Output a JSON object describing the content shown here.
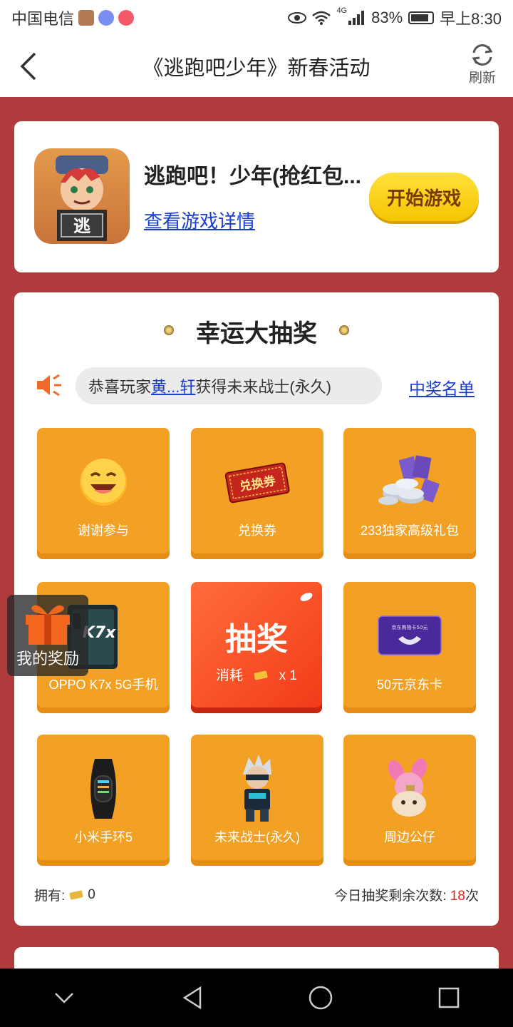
{
  "status_bar": {
    "carrier": "中国电信",
    "network": "4G",
    "battery": "83%",
    "time": "早上8:30"
  },
  "nav": {
    "title": "《逃跑吧少年》新春活动",
    "refresh_label": "刷新"
  },
  "game": {
    "name": "逃跑吧！少年(抢红包...",
    "icon_text": "逃",
    "detail_link": "查看游戏详情",
    "start_button": "开始游戏"
  },
  "lottery": {
    "title": "幸运大抽奖",
    "marquee_prefix": "恭喜玩家",
    "marquee_player": "黄...轩",
    "marquee_suffix": "获得未来战士(永久)",
    "winners_link": "中奖名单",
    "prizes": [
      {
        "label": "谢谢参与",
        "icon": "smiley-icon"
      },
      {
        "label": "兑换券",
        "icon": "coupon-icon",
        "art_text": "兑换券"
      },
      {
        "label": "233独家高级礼包",
        "icon": "coins-icon"
      },
      {
        "label": "OPPO K7x 5G手机",
        "icon": "phone-icon",
        "art_text": "K7x"
      },
      {
        "label": "50元京东卡",
        "icon": "jd-card-icon",
        "art_text": "京东购物卡50元"
      },
      {
        "label": "小米手环5",
        "icon": "band-icon"
      },
      {
        "label": "未来战士(永久)",
        "icon": "warrior-icon"
      },
      {
        "label": "周边公仔",
        "icon": "doll-icon"
      }
    ],
    "draw_button": "抽奖",
    "draw_cost_prefix": "消耗",
    "draw_cost_amount": "x 1",
    "own_label": "拥有:",
    "own_count": "0",
    "remain_label": "今日抽奖剩余次数: ",
    "remain_count": "18",
    "remain_unit": "次"
  },
  "my_reward": {
    "label": "我的奖励"
  },
  "colors": {
    "background": "#b03b3c",
    "prize_tile": "#f2a125",
    "draw_button": "#f23a18",
    "start_button": "#f6c500",
    "link": "#1a3ccf"
  }
}
